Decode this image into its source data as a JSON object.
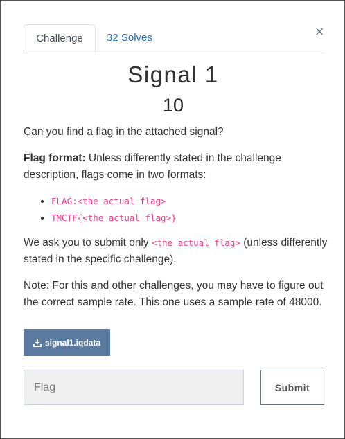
{
  "tabs": {
    "challenge_label": "Challenge",
    "solves_label": "32 Solves"
  },
  "close_icon": "×",
  "challenge": {
    "name": "Signal 1",
    "points": "10"
  },
  "description": {
    "intro": "Can you find a flag in the attached signal?",
    "flag_format_label": "Flag format:",
    "flag_format_text": "Unless differently stated in the challenge description, flags come in two formats:",
    "formats": [
      "FLAG:<the actual flag>",
      "TMCTF{<the actual flag>}"
    ],
    "submit_prefix": "We ask you to submit only",
    "submit_code": "<the actual flag>",
    "submit_suffix": "(unless differently stated in the specific challenge).",
    "note": "Note: For this and other challenges, you may have to figure out the correct sample rate. This one uses a sample rate of 48000."
  },
  "file": {
    "icon": "download-icon",
    "name": "signal1.iqdata"
  },
  "form": {
    "flag_placeholder": "Flag",
    "flag_value": "",
    "submit_label": "Submit"
  },
  "colors": {
    "link": "#2a6ebb",
    "code": "#e83e8c",
    "download_bg": "#5b7aa0"
  }
}
